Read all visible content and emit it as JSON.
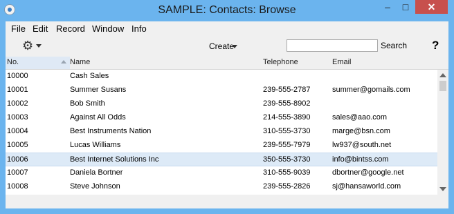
{
  "window": {
    "title": "SAMPLE: Contacts: Browse",
    "minimize": "–",
    "maximize": "□",
    "close": "✕"
  },
  "menu": [
    "File",
    "Edit",
    "Record",
    "Window",
    "Info"
  ],
  "toolbar": {
    "gear": "⚙",
    "create_label": "Create",
    "search_value": "",
    "search_label": "Search",
    "help_label": "?"
  },
  "columns": {
    "no": "No.",
    "name": "Name",
    "telephone": "Telephone",
    "email": "Email"
  },
  "rows": [
    {
      "no": "10000",
      "name": "Cash Sales",
      "tel": "",
      "email": ""
    },
    {
      "no": "10001",
      "name": "Summer Susans",
      "tel": "239-555-2787",
      "email": "summer@gomails.com"
    },
    {
      "no": "10002",
      "name": "Bob Smith",
      "tel": "239-555-8902",
      "email": ""
    },
    {
      "no": "10003",
      "name": "Against All Odds",
      "tel": "214-555-3890",
      "email": "sales@aao.com"
    },
    {
      "no": "10004",
      "name": "Best Instruments Nation",
      "tel": "310-555-3730",
      "email": "marge@bsn.com"
    },
    {
      "no": "10005",
      "name": "Lucas Williams",
      "tel": "239-555-7979",
      "email": "lw937@south.net"
    },
    {
      "no": "10006",
      "name": "Best Internet Solutions Inc",
      "tel": "350-555-3730",
      "email": "info@bintss.com",
      "selected": true
    },
    {
      "no": "10007",
      "name": "Daniela Bortner",
      "tel": "310-555-9039",
      "email": "dbortner@google.net"
    },
    {
      "no": "10008",
      "name": "Steve Johnson",
      "tel": "239-555-2826",
      "email": "sj@hansaworld.com"
    }
  ],
  "colors": {
    "titlebar": "#6bb4ee",
    "selection": "#ddeaf7",
    "close": "#c7504d"
  }
}
